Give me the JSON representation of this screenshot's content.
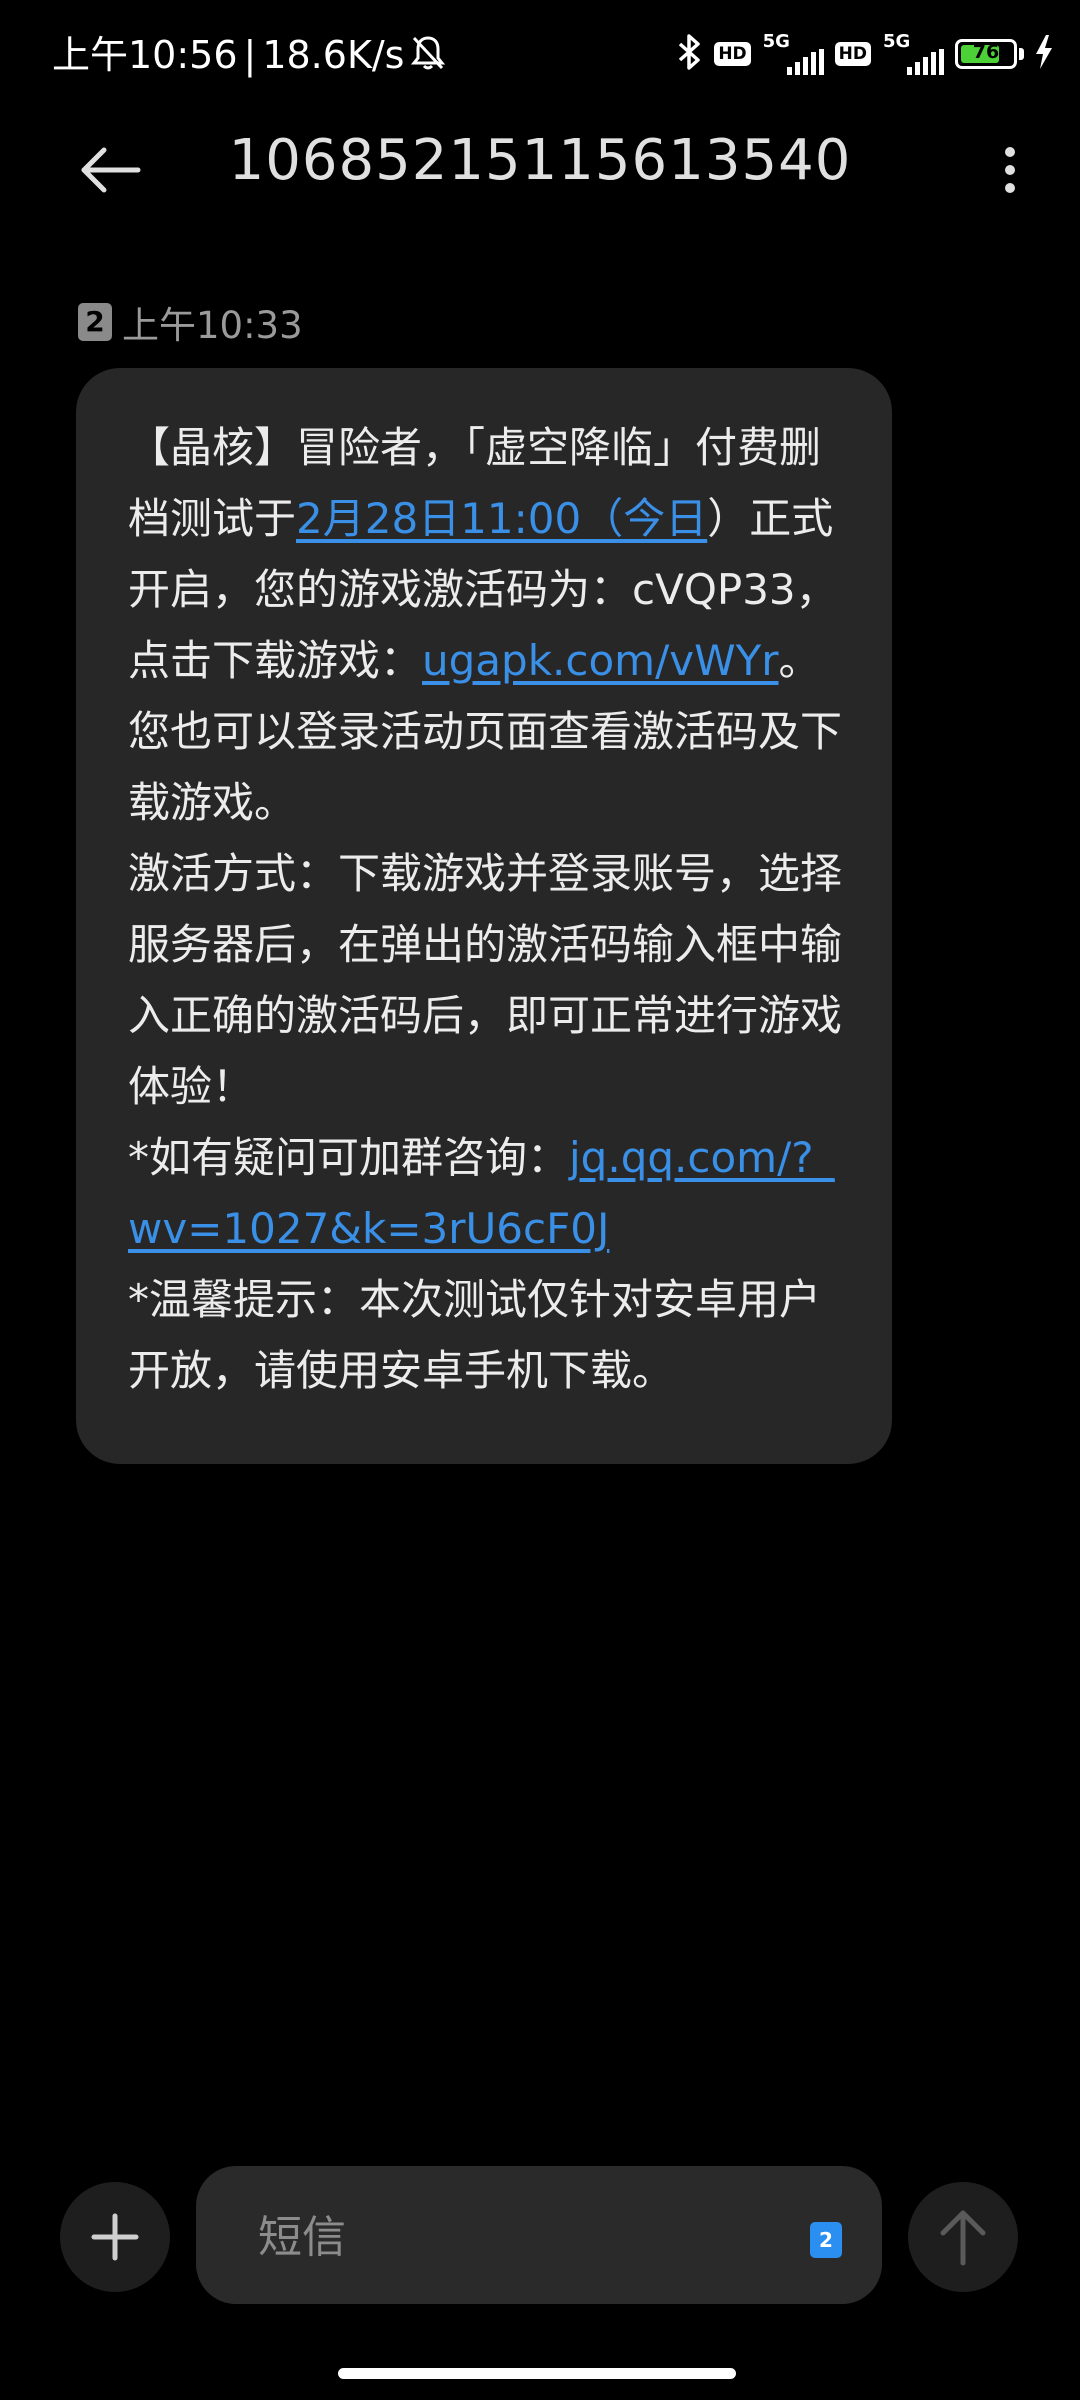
{
  "status_bar": {
    "time": "上午10:56",
    "separator": "|",
    "net_speed": "18.6K/s",
    "hd1": "HD",
    "net1": "5G",
    "hd2": "HD",
    "net2": "5G",
    "battery": "76",
    "battery_level_percent": 76,
    "icons": [
      "bell-off-icon",
      "bluetooth-icon",
      "signal-icon",
      "battery-icon",
      "charging-icon"
    ]
  },
  "header": {
    "title": "10685215115613540",
    "back_icon": "arrow-left-icon",
    "more_icon": "more-vertical-icon"
  },
  "message": {
    "sim": "2",
    "time": "上午10:33",
    "parts": [
      {
        "type": "text",
        "value": "【晶核】冒险者，「虚空降临」付费删档测试于"
      },
      {
        "type": "link",
        "value": "2月28日11:00（今日"
      },
      {
        "type": "text",
        "value": "）正式开启，您的游戏激活码为：cVQP33，点击下载游戏："
      },
      {
        "type": "link",
        "value": "ugapk.com/vWYr"
      },
      {
        "type": "text",
        "value": "。您也可以登录活动页面查看激活码及下载游戏。\n激活方式：下载游戏并登录账号，选择服务器后，在弹出的激活码输入框中输入正确的激活码后，即可正常进行游戏体验！\n*如有疑问可加群咨询："
      },
      {
        "type": "link",
        "value": "jq.qq.com/?_wv=1027&k=3rU6cF0J"
      },
      {
        "type": "text",
        "value": "\n*温馨提示：本次测试仅针对安卓用户开放，请使用安卓手机下载。"
      }
    ]
  },
  "composer": {
    "placeholder": "短信",
    "value": "",
    "sim": "2",
    "attach_icon": "plus-icon",
    "send_icon": "arrow-up-icon"
  },
  "colors": {
    "background": "#000000",
    "bubble": "#272727",
    "link": "#3a8fe6",
    "battery": "#4cd137",
    "sim_badge": "#2a8ff0"
  }
}
